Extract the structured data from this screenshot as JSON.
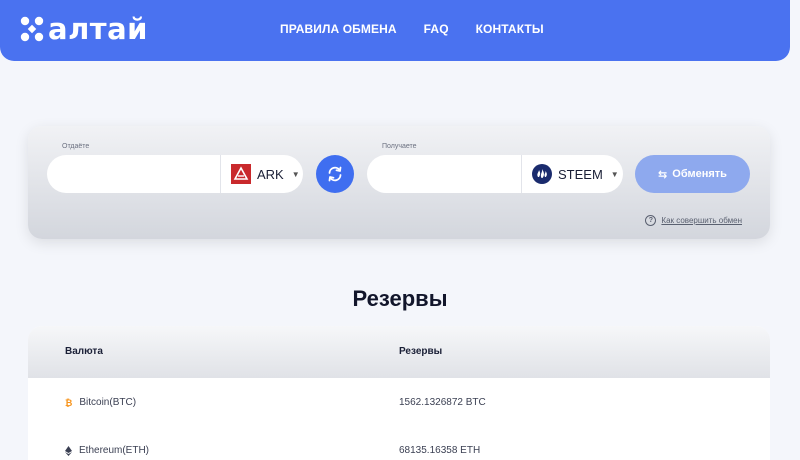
{
  "brand": {
    "logo_text": "алтай"
  },
  "nav": [
    {
      "label": "ПРАВИЛА ОБМЕНА"
    },
    {
      "label": "FAQ"
    },
    {
      "label": "КОНТАКТЫ"
    }
  ],
  "exchange": {
    "give_label": "Отдаёте",
    "give_value": "",
    "give_currency": "ARK",
    "give_icon": "ark-icon",
    "receive_label": "Получаете",
    "receive_value": "",
    "receive_currency": "STEEM",
    "receive_icon": "steem-icon",
    "swap_icon": "swap-arrows-icon",
    "exchange_button": "Обменять",
    "howto_link": "Как совершить обмен"
  },
  "reserves": {
    "title": "Резервы",
    "columns": [
      "Валюта",
      "Резервы"
    ],
    "rows": [
      {
        "currency": "Bitcoin(BTC)",
        "icon": "bitcoin-icon",
        "amount": "1562.1326872 BTC"
      },
      {
        "currency": "Ethereum(ETH)",
        "icon": "ethereum-icon",
        "amount": "68135.16358 ETH"
      }
    ]
  },
  "colors": {
    "primary": "#4a72f0",
    "swap_button": "#3f6ef0",
    "exchange_button": "#8ea9ee",
    "ark_red": "#c9292c",
    "steem_navy": "#1a2b6d",
    "bitcoin_orange": "#f7931a"
  }
}
